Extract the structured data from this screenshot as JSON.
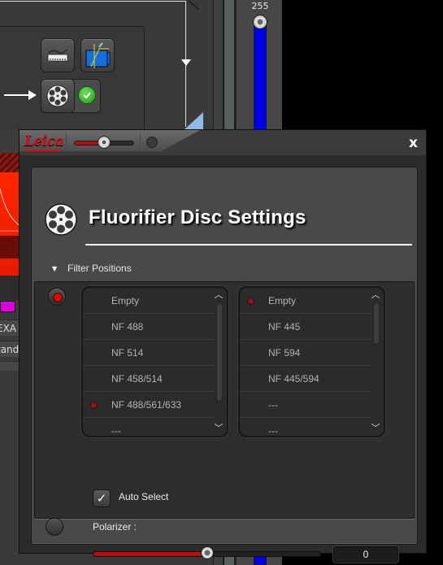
{
  "background": {
    "vertical_slider": {
      "value_label": "255",
      "value": 255,
      "color": "#0000e8"
    },
    "left_partial_labels": [
      "EXA",
      "tand"
    ],
    "tool_buttons": [
      "filter-strip-icon",
      "spectrum-detector-icon",
      "filter-wheel-icon",
      "active-check-icon"
    ],
    "accent_red": "#ff2600",
    "magenta_swatch": "#d800e0"
  },
  "dialog": {
    "brand": "Leica",
    "close_label": "x",
    "zoom_slider": {
      "fraction": 0.5
    },
    "title": "Fluorifier Disc Settings",
    "section": {
      "label": "Filter Positions",
      "expanded": true
    },
    "filter_wheel_1": {
      "selected": true,
      "items": [
        {
          "label": "Empty",
          "active": false
        },
        {
          "label": "NF 488",
          "active": false
        },
        {
          "label": "NF 514",
          "active": false
        },
        {
          "label": "NF 458/514",
          "active": false
        },
        {
          "label": "NF 488/561/633",
          "active": true
        },
        {
          "label": "---",
          "active": false
        }
      ]
    },
    "filter_wheel_2": {
      "items": [
        {
          "label": "Empty",
          "active": true
        },
        {
          "label": "NF 445",
          "active": false
        },
        {
          "label": "NF 594",
          "active": false
        },
        {
          "label": "NF 445/594",
          "active": false
        },
        {
          "label": "---",
          "active": false
        },
        {
          "label": "---",
          "active": false
        }
      ]
    },
    "auto_select": {
      "label": "Auto Select",
      "checked": true,
      "check_glyph": "✓"
    },
    "polarizer": {
      "label": "Polarizer :",
      "selected": false,
      "slider_fraction": 0.5,
      "value": "0"
    },
    "accent_red": "#d60a0a"
  }
}
